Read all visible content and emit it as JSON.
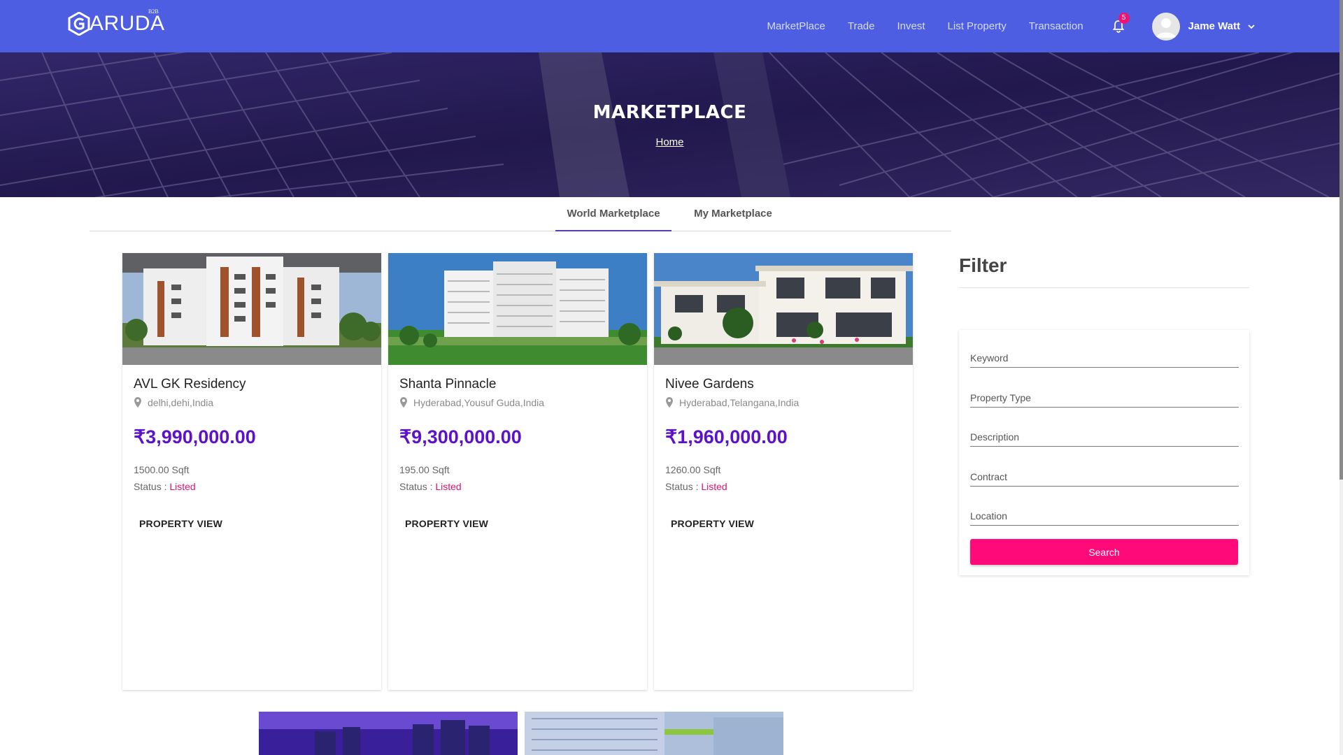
{
  "brand": {
    "name": "ARUDA",
    "tag": "B2B"
  },
  "nav": {
    "links": [
      "MarketPlace",
      "Trade",
      "Invest",
      "List Property",
      "Transaction"
    ],
    "notifications": "5",
    "user_name": "Jame Watt"
  },
  "hero": {
    "title": "MARKETPLACE",
    "breadcrumb": "Home"
  },
  "tabs": [
    "World Marketplace",
    "My Marketplace"
  ],
  "cards": [
    {
      "title": "AVL GK Residency",
      "location": "delhi,dehi,India",
      "price": "₹3,990,000.00",
      "area": "1500.00 Sqft",
      "status_label": "Status : ",
      "status": "Listed",
      "button": "PROPERTY VIEW"
    },
    {
      "title": "Shanta Pinnacle",
      "location": "Hyderabad,Yousuf Guda,India",
      "price": "₹9,300,000.00",
      "area": "195.00 Sqft",
      "status_label": "Status : ",
      "status": "Listed",
      "button": "PROPERTY VIEW"
    },
    {
      "title": "Nivee Gardens",
      "location": "Hyderabad,Telangana,India",
      "price": "₹1,960,000.00",
      "area": "1260.00 Sqft",
      "status_label": "Status : ",
      "status": "Listed",
      "button": "PROPERTY VIEW"
    }
  ],
  "filter": {
    "title": "Filter",
    "fields": [
      "Keyword",
      "Property Type",
      "Description",
      "Contract",
      "Location"
    ],
    "button": "Search"
  },
  "colors": {
    "navbar": "#4d5ee3",
    "price": "#5b12c9",
    "status": "#e0126b",
    "search_button": "#ff0a78",
    "tab_indicator": "#4d3bd9"
  }
}
